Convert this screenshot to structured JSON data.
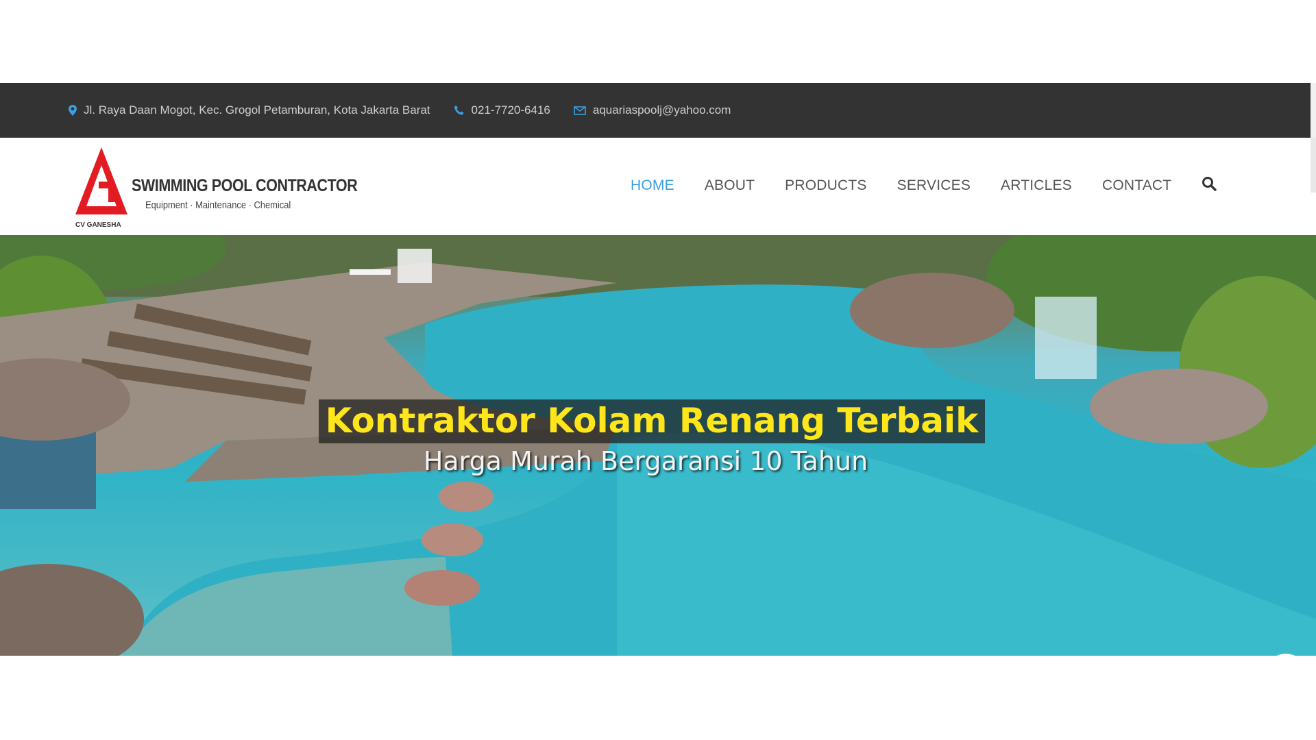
{
  "topbar": {
    "address": "Jl. Raya Daan Mogot, Kec. Grogol Petamburan, Kota Jakarta Barat",
    "phone": "021-7720-6416",
    "email": "aquariaspoolj@yahoo.com",
    "icons": [
      "map-marker-icon",
      "phone-icon",
      "envelope-icon"
    ],
    "icon_color": "#3b9fe0"
  },
  "logo": {
    "brand": "SWIMMING POOL CONTRACTOR",
    "tagline": "Equipment · Maintenance · Chemical",
    "company": "CV GANESHA",
    "mark_color": "#e31b23"
  },
  "nav": {
    "items": [
      "HOME",
      "ABOUT",
      "PRODUCTS",
      "SERVICES",
      "ARTICLES",
      "CONTACT"
    ],
    "active": "HOME",
    "active_color": "#3b9fe0",
    "search_icon": "search-icon"
  },
  "hero": {
    "headline": "Kontraktor Kolam Renang Terbaik",
    "subheadline": "Harga Murah Bergaransi 10 Tahun",
    "headline_color": "#ffe61a"
  },
  "whatsapp": {
    "icon": "whatsapp-icon",
    "color": "#25d366"
  }
}
